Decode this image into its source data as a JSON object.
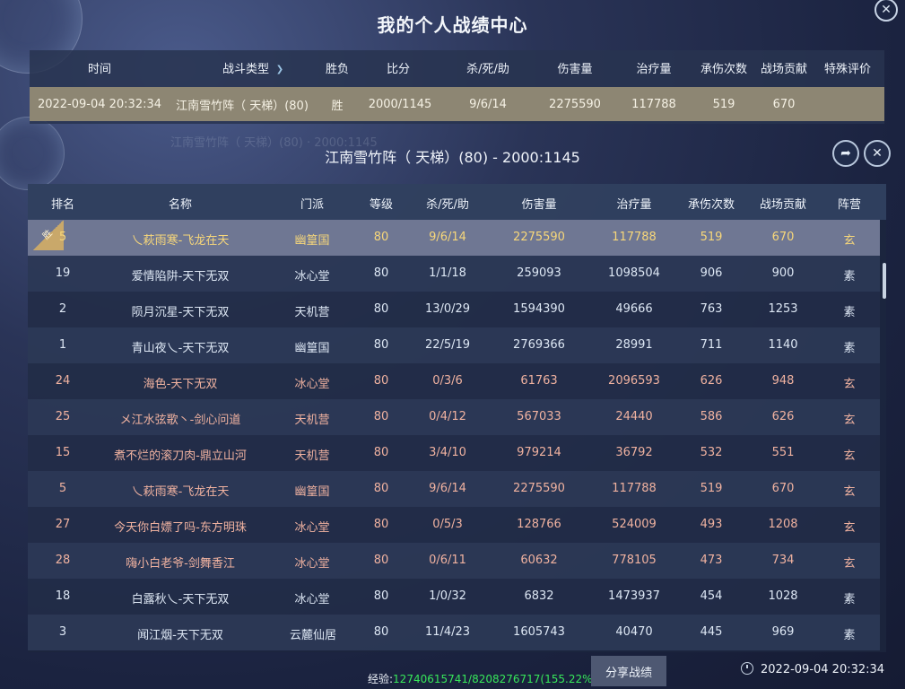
{
  "window": {
    "title": "我的个人战绩中心",
    "close_glyph": "✕"
  },
  "summary": {
    "columns": [
      "时间",
      "战斗类型",
      "胜负",
      "比分",
      "杀/死/助",
      "伤害量",
      "治疗量",
      "承伤次数",
      "战场贡献",
      "特殊评价"
    ],
    "row": {
      "time": "2022-09-04 20:32:34",
      "type": "江南雪竹阵（ 天梯）(80)",
      "result": "胜",
      "score": "2000/1145",
      "kda": "9/6/14",
      "damage": "2275590",
      "heal": "117788",
      "hits_taken": "519",
      "contribution": "670",
      "special": ""
    }
  },
  "ghost_text": "江南雪竹阵（ 天梯）(80) · 2000:1145",
  "match": {
    "title": "江南雪竹阵（ 天梯）(80) - 2000:1145",
    "share_glyph": "➦",
    "close_glyph": "✕"
  },
  "table": {
    "columns": [
      "排名",
      "名称",
      "门派",
      "等级",
      "杀/死/助",
      "伤害量",
      "治疗量",
      "承伤次数",
      "战场贡献",
      "阵营"
    ],
    "win_badge": "胜",
    "rows": [
      {
        "rank": "5",
        "name": "乀萩雨寒-飞龙在天",
        "sect": "幽篁国",
        "level": "80",
        "kda": "9/6/14",
        "damage": "2275590",
        "heal": "117788",
        "hits": "519",
        "contrib": "670",
        "camp": "玄"
      },
      {
        "rank": "19",
        "name": "爱情陷阱-天下无双",
        "sect": "冰心堂",
        "level": "80",
        "kda": "1/1/18",
        "damage": "259093",
        "heal": "1098504",
        "hits": "906",
        "contrib": "900",
        "camp": "素"
      },
      {
        "rank": "2",
        "name": "陨月沉星-天下无双",
        "sect": "天机营",
        "level": "80",
        "kda": "13/0/29",
        "damage": "1594390",
        "heal": "49666",
        "hits": "763",
        "contrib": "1253",
        "camp": "素"
      },
      {
        "rank": "1",
        "name": "青山夜乀-天下无双",
        "sect": "幽篁国",
        "level": "80",
        "kda": "22/5/19",
        "damage": "2769366",
        "heal": "28991",
        "hits": "711",
        "contrib": "1140",
        "camp": "素"
      },
      {
        "rank": "24",
        "name": "海色-天下无双",
        "sect": "冰心堂",
        "level": "80",
        "kda": "0/3/6",
        "damage": "61763",
        "heal": "2096593",
        "hits": "626",
        "contrib": "948",
        "camp": "玄"
      },
      {
        "rank": "25",
        "name": "メ江水弦歌丶-剑心问道",
        "sect": "天机营",
        "level": "80",
        "kda": "0/4/12",
        "damage": "567033",
        "heal": "24440",
        "hits": "586",
        "contrib": "626",
        "camp": "玄"
      },
      {
        "rank": "15",
        "name": "煮不烂的滚刀肉-鼎立山河",
        "sect": "天机营",
        "level": "80",
        "kda": "3/4/10",
        "damage": "979214",
        "heal": "36792",
        "hits": "532",
        "contrib": "551",
        "camp": "玄"
      },
      {
        "rank": "5",
        "name": "乀萩雨寒-飞龙在天",
        "sect": "幽篁国",
        "level": "80",
        "kda": "9/6/14",
        "damage": "2275590",
        "heal": "117788",
        "hits": "519",
        "contrib": "670",
        "camp": "玄"
      },
      {
        "rank": "27",
        "name": "今天你白嫖了吗-东方明珠",
        "sect": "冰心堂",
        "level": "80",
        "kda": "0/5/3",
        "damage": "128766",
        "heal": "524009",
        "hits": "493",
        "contrib": "1208",
        "camp": "玄"
      },
      {
        "rank": "28",
        "name": "嗨小白老爷-剑舞香江",
        "sect": "冰心堂",
        "level": "80",
        "kda": "0/6/11",
        "damage": "60632",
        "heal": "778105",
        "hits": "473",
        "contrib": "734",
        "camp": "玄"
      },
      {
        "rank": "18",
        "name": "白露秋乀-天下无双",
        "sect": "冰心堂",
        "level": "80",
        "kda": "1/0/32",
        "damage": "6832",
        "heal": "1473937",
        "hits": "454",
        "contrib": "1028",
        "camp": "素"
      },
      {
        "rank": "3",
        "name": "闻江烟-天下无双",
        "sect": "云麓仙居",
        "level": "80",
        "kda": "11/4/23",
        "damage": "1605743",
        "heal": "40470",
        "hits": "445",
        "contrib": "969",
        "camp": "素"
      }
    ]
  },
  "footer": {
    "exp_label": "经验:",
    "exp_value": "12740615741/8208276717(155.22%)",
    "share_label": "分享战绩",
    "time": "2022-09-04 20:32:34"
  },
  "colors": {
    "camp_xuan": "#f0b2a0",
    "camp_su": "#dde7f4",
    "highlight_text": "#f7d77a"
  }
}
